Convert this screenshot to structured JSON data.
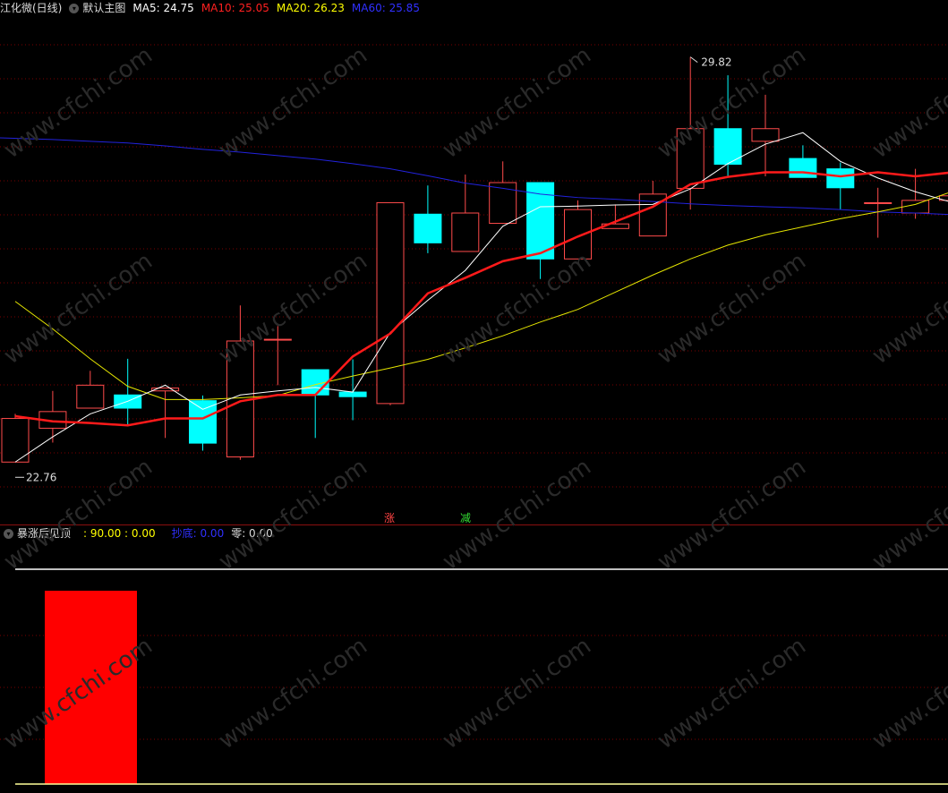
{
  "main_header": {
    "title": "江化微(日线)",
    "view_label": "默认主图",
    "ma_labels": [
      {
        "label": "MA5: 24.75",
        "color": "#ffffff"
      },
      {
        "label": "MA10: 25.05",
        "color": "#ff2020"
      },
      {
        "label": "MA20: 26.23",
        "color": "#ffff00"
      },
      {
        "label": "MA60: 25.85",
        "color": "#2020ff"
      }
    ]
  },
  "markers": {
    "high_label": "29.82",
    "low_label": "22.76",
    "zhang_label": "涨",
    "jian_label": "减"
  },
  "sub_header": {
    "title": "暴涨后见顶",
    "value_text": ": 90.00 : 0.00",
    "chao_label": "抄底: 0.00",
    "ling_label": "零: 0.00"
  },
  "watermark_text": "www.cfchi.com",
  "colors": {
    "up": "#ff4b4b",
    "down": "#00ffff",
    "ma5": "#ffffff",
    "ma10": "#ff1a1a",
    "ma20": "#e6e600",
    "ma60": "#2222dd",
    "grid": "#7a0000"
  },
  "chart_data": [
    {
      "type": "candlestick",
      "title": "江化微(日线)",
      "candles": [
        {
          "o": 22.76,
          "c": 23.52,
          "h": 23.6,
          "l": 22.76
        },
        {
          "o": 23.35,
          "c": 23.64,
          "h": 24.0,
          "l": 23.1
        },
        {
          "o": 23.7,
          "c": 24.1,
          "h": 24.35,
          "l": 23.7
        },
        {
          "o": 23.93,
          "c": 23.7,
          "h": 24.56,
          "l": 23.38
        },
        {
          "o": 24.0,
          "c": 24.05,
          "h": 24.05,
          "l": 23.18
        },
        {
          "o": 23.83,
          "c": 23.09,
          "h": 23.92,
          "l": 22.96
        },
        {
          "o": 22.85,
          "c": 24.87,
          "h": 25.49,
          "l": 22.8
        },
        {
          "o": 24.9,
          "c": 24.9,
          "h": 25.13,
          "l": 24.1
        },
        {
          "o": 24.37,
          "c": 23.93,
          "h": 24.37,
          "l": 23.18
        },
        {
          "o": 23.98,
          "c": 23.9,
          "h": 24.55,
          "l": 23.49
        },
        {
          "o": 23.78,
          "c": 27.28,
          "h": 27.28,
          "l": 23.75
        },
        {
          "o": 27.08,
          "c": 26.58,
          "h": 27.58,
          "l": 26.4
        },
        {
          "o": 26.43,
          "c": 27.1,
          "h": 27.77,
          "l": 26.43
        },
        {
          "o": 26.92,
          "c": 27.63,
          "h": 28.0,
          "l": 26.92
        },
        {
          "o": 27.63,
          "c": 26.3,
          "h": 27.63,
          "l": 25.95
        },
        {
          "o": 26.3,
          "c": 27.16,
          "h": 27.32,
          "l": 26.3
        },
        {
          "o": 26.83,
          "c": 26.91,
          "h": 27.25,
          "l": 26.83
        },
        {
          "o": 26.7,
          "c": 27.43,
          "h": 27.66,
          "l": 26.7
        },
        {
          "o": 27.53,
          "c": 28.57,
          "h": 29.82,
          "l": 27.16
        },
        {
          "o": 28.57,
          "c": 27.95,
          "h": 29.5,
          "l": 27.74
        },
        {
          "o": 28.35,
          "c": 28.57,
          "h": 29.16,
          "l": 27.74
        },
        {
          "o": 28.05,
          "c": 27.72,
          "h": 28.28,
          "l": 27.72
        },
        {
          "o": 27.87,
          "c": 27.54,
          "h": 27.98,
          "l": 27.16
        },
        {
          "o": 27.28,
          "c": 27.28,
          "h": 27.54,
          "l": 26.67
        },
        {
          "o": 27.1,
          "c": 27.32,
          "h": 27.87,
          "l": 27.0
        },
        {
          "o": 27.32,
          "c": 27.4,
          "h": 27.5,
          "l": 27.32
        }
      ],
      "ma5": [
        22.76,
        23.2,
        23.6,
        23.82,
        24.1,
        23.68,
        23.93,
        24.0,
        24.06,
        23.98,
        25.02,
        25.58,
        26.1,
        26.87,
        27.21,
        27.22,
        27.24,
        27.25,
        27.52,
        27.96,
        28.3,
        28.5,
        28.0,
        27.71,
        27.47,
        27.28
      ],
      "ma10": [
        23.56,
        23.47,
        23.44,
        23.4,
        23.52,
        23.52,
        23.82,
        23.93,
        23.93,
        24.6,
        25.0,
        25.7,
        25.97,
        26.26,
        26.4,
        26.69,
        26.95,
        27.21,
        27.6,
        27.73,
        27.81,
        27.81,
        27.74,
        27.81,
        27.74,
        27.81
      ],
      "ma20": [
        25.56,
        25.08,
        24.56,
        24.08,
        23.85,
        23.85,
        23.88,
        23.92,
        24.11,
        24.26,
        24.4,
        24.55,
        24.75,
        24.96,
        25.2,
        25.42,
        25.72,
        26.02,
        26.3,
        26.54,
        26.72,
        26.86,
        27.0,
        27.12,
        27.25
      ],
      "ma60": [
        28.41,
        28.38,
        28.35,
        28.32,
        28.27,
        28.21,
        28.16,
        28.1,
        28.04,
        27.96,
        27.87,
        27.75,
        27.62,
        27.53,
        27.43,
        27.37,
        27.34,
        27.3,
        27.26,
        27.23,
        27.21,
        27.19,
        27.16,
        27.12,
        27.1,
        27.07
      ],
      "ylim": [
        22.0,
        30.5
      ],
      "annotations": [
        {
          "text": "29.82",
          "candle_index": 18,
          "at": "high"
        },
        {
          "text": "22.76",
          "candle_index": 0,
          "at": "low"
        }
      ]
    },
    {
      "type": "bar",
      "title": "暴涨后见顶",
      "categories": [
        "1"
      ],
      "values": [
        90
      ],
      "reference_line": 100,
      "ylim": [
        0,
        100
      ]
    }
  ]
}
